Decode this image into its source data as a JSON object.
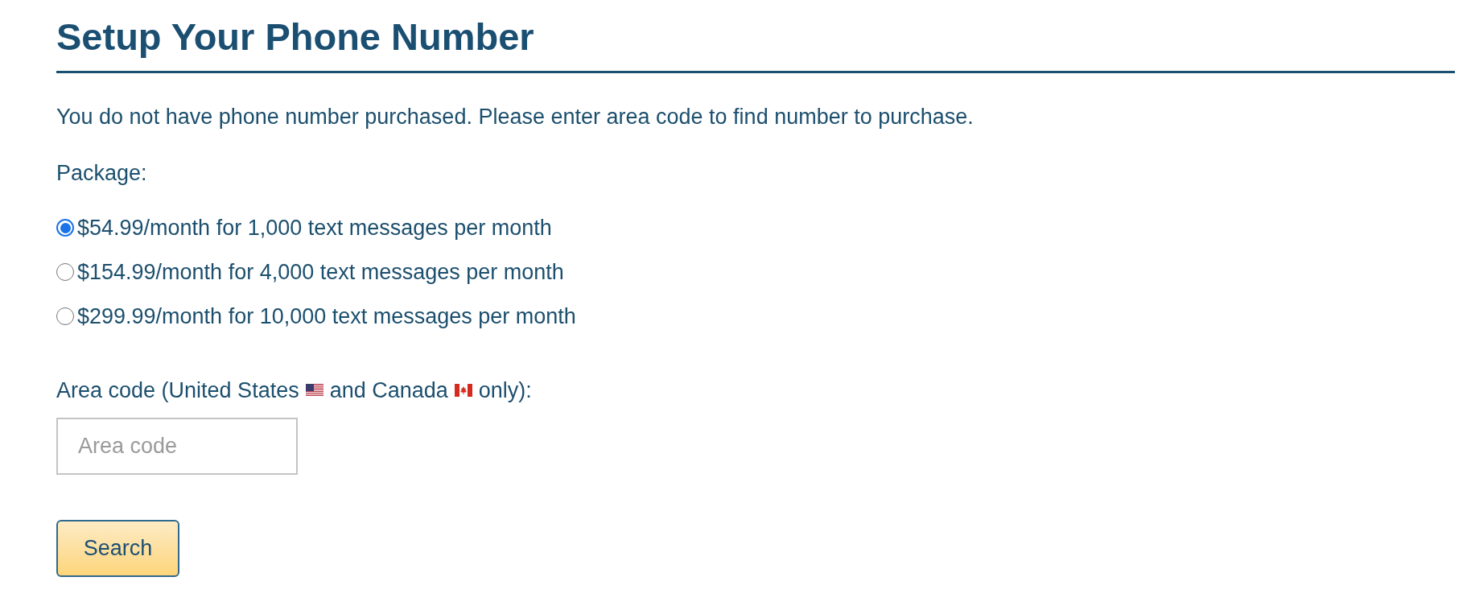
{
  "title": "Setup Your Phone Number",
  "message": "You do not have phone number purchased. Please enter area code to find number to purchase.",
  "package_label": "Package:",
  "packages": [
    {
      "label": "$54.99/month for 1,000 text messages per month",
      "selected": true
    },
    {
      "label": "$154.99/month for 4,000 text messages per month",
      "selected": false
    },
    {
      "label": "$299.99/month for 10,000 text messages per month",
      "selected": false
    }
  ],
  "area_code_label": [
    {
      "text": "Area code (United States",
      "kind": "us_flag"
    },
    {
      "text": "and Canada",
      "kind": "ca_flag"
    },
    {
      "text": "only):",
      "kind": "plain"
    }
  ],
  "area_code_field": {
    "placeholder": "Area code"
  },
  "search_button": "Search"
}
